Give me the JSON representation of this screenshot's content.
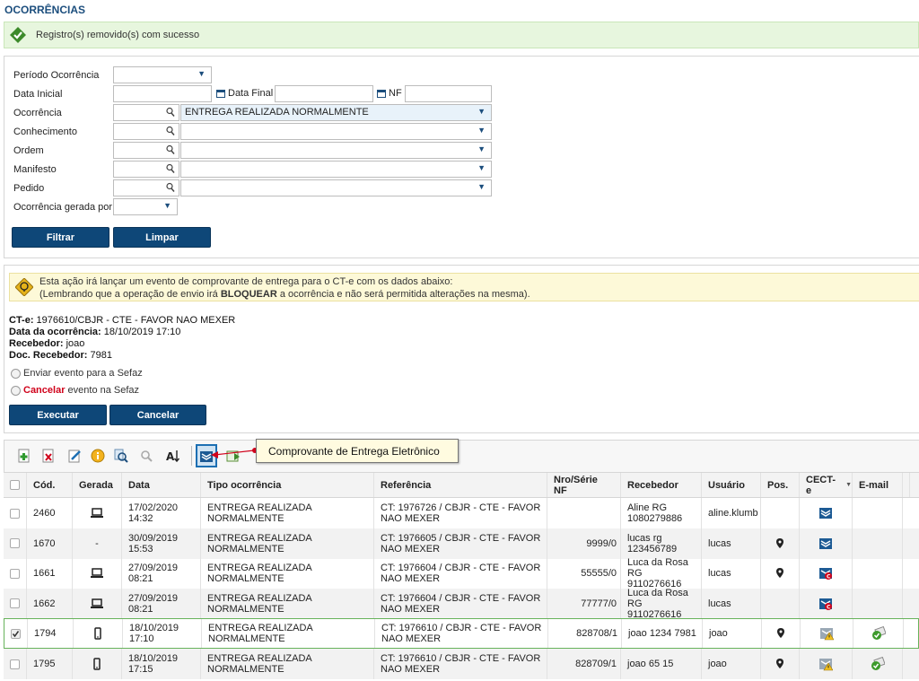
{
  "page": {
    "title": "OCORRÊNCIAS"
  },
  "success": {
    "message": "Registro(s) removido(s) com sucesso"
  },
  "filters": {
    "periodo_label": "Período Ocorrência",
    "data_inicial_label": "Data Inicial",
    "data_final_label": "Data Final",
    "nf_label": "NF",
    "ocorrencia_label": "Ocorrência",
    "ocorrencia_value": "ENTREGA REALIZADA NORMALMENTE",
    "conhecimento_label": "Conhecimento",
    "ordem_label": "Ordem",
    "manifesto_label": "Manifesto",
    "pedido_label": "Pedido",
    "gerada_por_label": "Ocorrência gerada por",
    "filtrar": "Filtrar",
    "limpar": "Limpar"
  },
  "warning": {
    "line1": "Esta ação irá lançar um evento de comprovante de entrega para o CT-e com os dados abaixo:",
    "line2_a": "(Lembrando que a operação de envio irá ",
    "line2_b": "BLOQUEAR",
    "line2_c": " a ocorrência e não será permitida alterações na mesma)."
  },
  "details": {
    "cte_label": "CT-e:",
    "cte_value": " 1976610/CBJR - CTE - FAVOR NAO MEXER",
    "data_label": "Data da ocorrência:",
    "data_value": " 18/10/2019 17:10",
    "recebedor_label": "Recebedor:",
    "recebedor_value": " joao",
    "doc_label": "Doc. Recebedor:",
    "doc_value": " 7981"
  },
  "options": {
    "enviar": "Enviar evento para a Sefaz",
    "cancelar_word": "Cancelar",
    "cancelar_rest": " evento na Sefaz",
    "executar": "Executar",
    "cancelar_btn": "Cancelar"
  },
  "toolbar": {
    "tooltip": "Comprovante de Entrega Eletrônico",
    "icons": [
      "add-icon",
      "delete-icon",
      "edit-icon",
      "info-icon",
      "search-icon",
      "search-disabled-icon",
      "sort-icon",
      "cte-receipt-icon",
      "export-icon"
    ]
  },
  "table": {
    "headers": [
      "Cód.",
      "Gerada",
      "Data",
      "Tipo ocorrência",
      "Referência",
      "Nro/Série NF",
      "Recebedor",
      "Usuário",
      "Pos.",
      "CECT-e",
      "E-mail"
    ],
    "rows": [
      {
        "checked": false,
        "cod": "2460",
        "gerada": "desktop",
        "data1": "17/02/2020",
        "data2": "14:32",
        "tipo1": "ENTREGA REALIZADA",
        "tipo2": "NORMALMENTE",
        "ref1": "CT: 1976726 / CBJR - CTE - FAVOR",
        "ref2": "NAO MEXER",
        "nf": "",
        "rec1": "Aline RG",
        "rec2": "1080279886",
        "usuario": "aline.klumb",
        "pos": false,
        "cecte": "cte-icon",
        "email": ""
      },
      {
        "checked": false,
        "cod": "1670",
        "gerada": "-",
        "data1": "30/09/2019",
        "data2": "15:53",
        "tipo1": "ENTREGA REALIZADA",
        "tipo2": "NORMALMENTE",
        "ref1": "CT: 1976605 / CBJR - CTE - FAVOR",
        "ref2": "NAO MEXER",
        "nf": "9999/0",
        "rec1": "lucas rg",
        "rec2": "123456789",
        "usuario": "lucas",
        "pos": true,
        "cecte": "cte-icon",
        "email": ""
      },
      {
        "checked": false,
        "cod": "1661",
        "gerada": "desktop",
        "data1": "27/09/2019",
        "data2": "08:21",
        "tipo1": "ENTREGA REALIZADA",
        "tipo2": "NORMALMENTE",
        "ref1": "CT: 1976604 / CBJR - CTE - FAVOR",
        "ref2": "NAO MEXER",
        "nf": "55555/0",
        "rec1": "Luca da Rosa RG",
        "rec2": "9110276616",
        "usuario": "lucas",
        "pos": true,
        "cecte": "cte-cancel-icon",
        "email": ""
      },
      {
        "checked": false,
        "cod": "1662",
        "gerada": "desktop",
        "data1": "27/09/2019",
        "data2": "08:21",
        "tipo1": "ENTREGA REALIZADA",
        "tipo2": "NORMALMENTE",
        "ref1": "CT: 1976604 / CBJR - CTE - FAVOR",
        "ref2": "NAO MEXER",
        "nf": "77777/0",
        "rec1": "Luca da Rosa RG",
        "rec2": "9110276616",
        "usuario": "lucas",
        "pos": false,
        "cecte": "cte-cancel-icon",
        "email": ""
      },
      {
        "checked": true,
        "cod": "1794",
        "gerada": "mobile",
        "data1": "18/10/2019",
        "data2": "17:10",
        "tipo1": "ENTREGA REALIZADA",
        "tipo2": "NORMALMENTE",
        "ref1": "CT: 1976610 / CBJR - CTE - FAVOR",
        "ref2": "NAO MEXER",
        "nf": "828708/1",
        "rec1": "joao 1234 7981",
        "rec2": "",
        "usuario": "joao",
        "pos": true,
        "cecte": "cte-warning-icon",
        "email": "email-sent-icon"
      },
      {
        "checked": false,
        "cod": "1795",
        "gerada": "mobile",
        "data1": "18/10/2019",
        "data2": "17:15",
        "tipo1": "ENTREGA REALIZADA",
        "tipo2": "NORMALMENTE",
        "ref1": "CT: 1976610 / CBJR - CTE - FAVOR",
        "ref2": "NAO MEXER",
        "nf": "828709/1",
        "rec1": "joao 65 15",
        "rec2": "",
        "usuario": "joao",
        "pos": true,
        "cecte": "cte-warning-icon",
        "email": "email-sent-icon"
      }
    ]
  }
}
